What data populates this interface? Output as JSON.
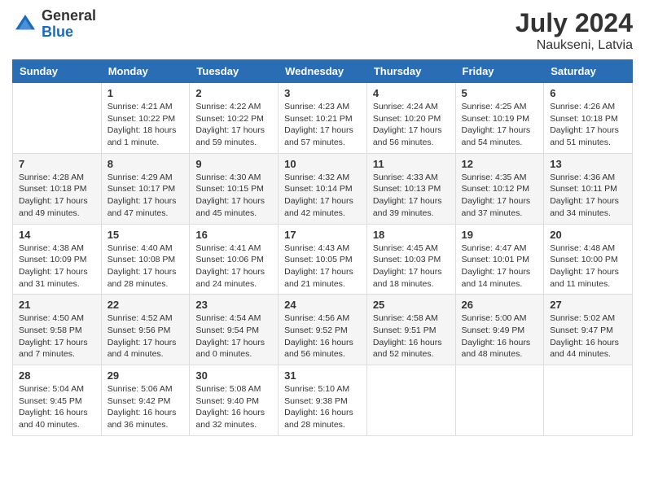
{
  "header": {
    "logo_general": "General",
    "logo_blue": "Blue",
    "month_year": "July 2024",
    "location": "Naukseni, Latvia"
  },
  "weekdays": [
    "Sunday",
    "Monday",
    "Tuesday",
    "Wednesday",
    "Thursday",
    "Friday",
    "Saturday"
  ],
  "weeks": [
    [
      {
        "day": "",
        "info": ""
      },
      {
        "day": "1",
        "info": "Sunrise: 4:21 AM\nSunset: 10:22 PM\nDaylight: 18 hours\nand 1 minute."
      },
      {
        "day": "2",
        "info": "Sunrise: 4:22 AM\nSunset: 10:22 PM\nDaylight: 17 hours\nand 59 minutes."
      },
      {
        "day": "3",
        "info": "Sunrise: 4:23 AM\nSunset: 10:21 PM\nDaylight: 17 hours\nand 57 minutes."
      },
      {
        "day": "4",
        "info": "Sunrise: 4:24 AM\nSunset: 10:20 PM\nDaylight: 17 hours\nand 56 minutes."
      },
      {
        "day": "5",
        "info": "Sunrise: 4:25 AM\nSunset: 10:19 PM\nDaylight: 17 hours\nand 54 minutes."
      },
      {
        "day": "6",
        "info": "Sunrise: 4:26 AM\nSunset: 10:18 PM\nDaylight: 17 hours\nand 51 minutes."
      }
    ],
    [
      {
        "day": "7",
        "info": "Sunrise: 4:28 AM\nSunset: 10:18 PM\nDaylight: 17 hours\nand 49 minutes."
      },
      {
        "day": "8",
        "info": "Sunrise: 4:29 AM\nSunset: 10:17 PM\nDaylight: 17 hours\nand 47 minutes."
      },
      {
        "day": "9",
        "info": "Sunrise: 4:30 AM\nSunset: 10:15 PM\nDaylight: 17 hours\nand 45 minutes."
      },
      {
        "day": "10",
        "info": "Sunrise: 4:32 AM\nSunset: 10:14 PM\nDaylight: 17 hours\nand 42 minutes."
      },
      {
        "day": "11",
        "info": "Sunrise: 4:33 AM\nSunset: 10:13 PM\nDaylight: 17 hours\nand 39 minutes."
      },
      {
        "day": "12",
        "info": "Sunrise: 4:35 AM\nSunset: 10:12 PM\nDaylight: 17 hours\nand 37 minutes."
      },
      {
        "day": "13",
        "info": "Sunrise: 4:36 AM\nSunset: 10:11 PM\nDaylight: 17 hours\nand 34 minutes."
      }
    ],
    [
      {
        "day": "14",
        "info": "Sunrise: 4:38 AM\nSunset: 10:09 PM\nDaylight: 17 hours\nand 31 minutes."
      },
      {
        "day": "15",
        "info": "Sunrise: 4:40 AM\nSunset: 10:08 PM\nDaylight: 17 hours\nand 28 minutes."
      },
      {
        "day": "16",
        "info": "Sunrise: 4:41 AM\nSunset: 10:06 PM\nDaylight: 17 hours\nand 24 minutes."
      },
      {
        "day": "17",
        "info": "Sunrise: 4:43 AM\nSunset: 10:05 PM\nDaylight: 17 hours\nand 21 minutes."
      },
      {
        "day": "18",
        "info": "Sunrise: 4:45 AM\nSunset: 10:03 PM\nDaylight: 17 hours\nand 18 minutes."
      },
      {
        "day": "19",
        "info": "Sunrise: 4:47 AM\nSunset: 10:01 PM\nDaylight: 17 hours\nand 14 minutes."
      },
      {
        "day": "20",
        "info": "Sunrise: 4:48 AM\nSunset: 10:00 PM\nDaylight: 17 hours\nand 11 minutes."
      }
    ],
    [
      {
        "day": "21",
        "info": "Sunrise: 4:50 AM\nSunset: 9:58 PM\nDaylight: 17 hours\nand 7 minutes."
      },
      {
        "day": "22",
        "info": "Sunrise: 4:52 AM\nSunset: 9:56 PM\nDaylight: 17 hours\nand 4 minutes."
      },
      {
        "day": "23",
        "info": "Sunrise: 4:54 AM\nSunset: 9:54 PM\nDaylight: 17 hours\nand 0 minutes."
      },
      {
        "day": "24",
        "info": "Sunrise: 4:56 AM\nSunset: 9:52 PM\nDaylight: 16 hours\nand 56 minutes."
      },
      {
        "day": "25",
        "info": "Sunrise: 4:58 AM\nSunset: 9:51 PM\nDaylight: 16 hours\nand 52 minutes."
      },
      {
        "day": "26",
        "info": "Sunrise: 5:00 AM\nSunset: 9:49 PM\nDaylight: 16 hours\nand 48 minutes."
      },
      {
        "day": "27",
        "info": "Sunrise: 5:02 AM\nSunset: 9:47 PM\nDaylight: 16 hours\nand 44 minutes."
      }
    ],
    [
      {
        "day": "28",
        "info": "Sunrise: 5:04 AM\nSunset: 9:45 PM\nDaylight: 16 hours\nand 40 minutes."
      },
      {
        "day": "29",
        "info": "Sunrise: 5:06 AM\nSunset: 9:42 PM\nDaylight: 16 hours\nand 36 minutes."
      },
      {
        "day": "30",
        "info": "Sunrise: 5:08 AM\nSunset: 9:40 PM\nDaylight: 16 hours\nand 32 minutes."
      },
      {
        "day": "31",
        "info": "Sunrise: 5:10 AM\nSunset: 9:38 PM\nDaylight: 16 hours\nand 28 minutes."
      },
      {
        "day": "",
        "info": ""
      },
      {
        "day": "",
        "info": ""
      },
      {
        "day": "",
        "info": ""
      }
    ]
  ]
}
